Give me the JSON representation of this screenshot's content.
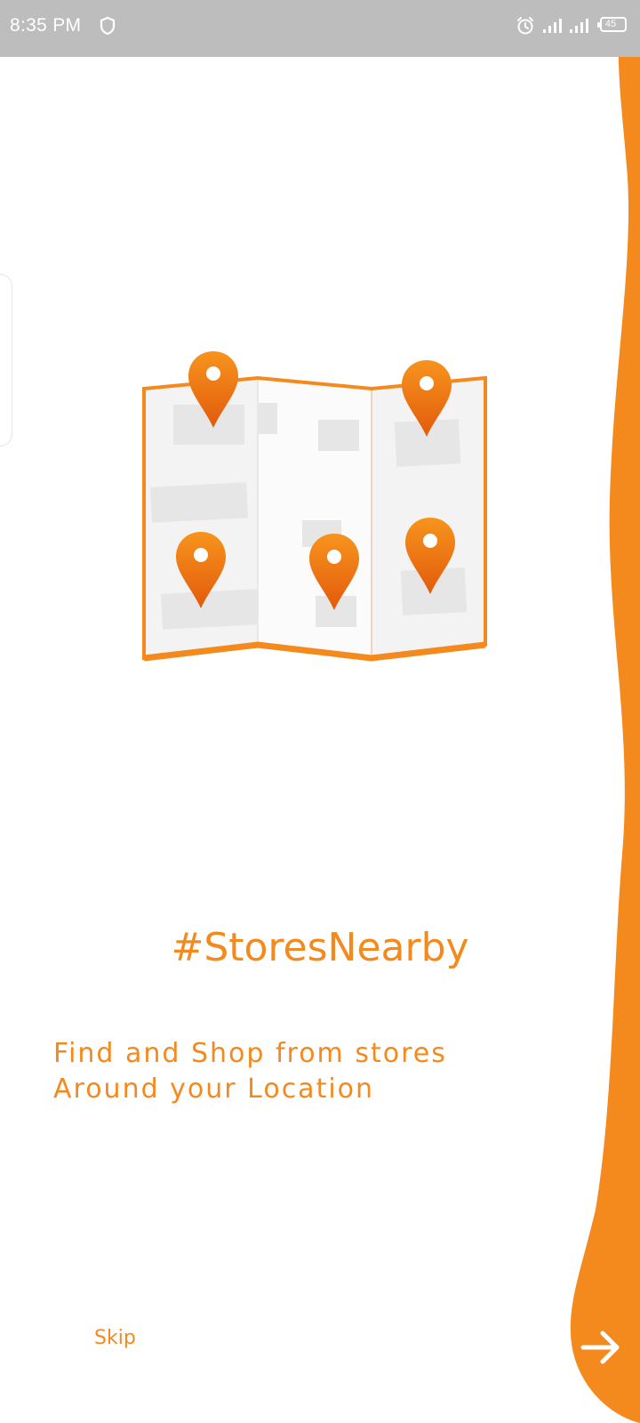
{
  "status_bar": {
    "time": "8:35 PM",
    "battery": "45",
    "icons": [
      "shield-icon",
      "alarm-icon",
      "signal-icon",
      "signal-icon",
      "battery-icon"
    ]
  },
  "onboarding": {
    "title": "#StoresNearby",
    "description_lines": [
      "Find and Shop from stores",
      "Around your Location"
    ],
    "skip_label": "Skip",
    "next_icon": "arrow-right-icon",
    "illustration": "map-with-pins"
  },
  "colors": {
    "accent": "#f48a1e",
    "accent_dark": "#c9671a",
    "status_bar": "#bdbdbd",
    "background": "#ffffff"
  }
}
